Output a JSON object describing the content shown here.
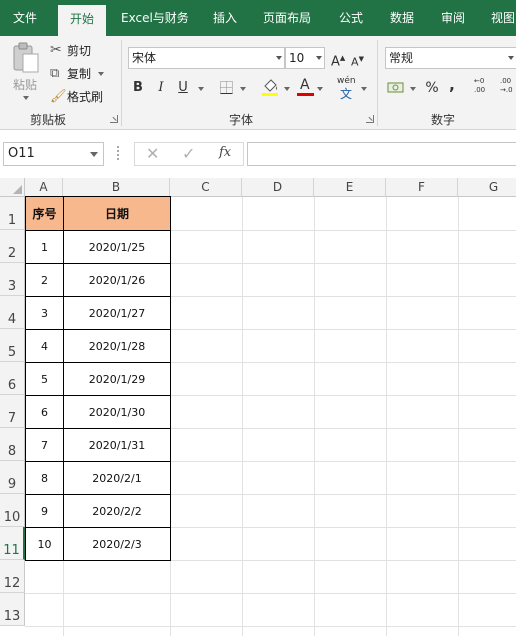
{
  "ribbon_tabs": [
    "文件",
    "开始",
    "Excel与财务",
    "插入",
    "页面布局",
    "公式",
    "数据",
    "审阅",
    "视图"
  ],
  "active_tab": "开始",
  "clipboard": {
    "paste_label": "粘贴",
    "cut_label": "剪切",
    "copy_label": "复制",
    "format_painter_label": "格式刷",
    "group_label": "剪贴板"
  },
  "font": {
    "font_name": "宋体",
    "font_size": "10",
    "bold": "B",
    "italic": "I",
    "underline": "U",
    "font_color_glyph": "A",
    "phonetic_glyph": "wén",
    "group_label": "字体"
  },
  "number": {
    "format": "常规",
    "percent": "%",
    "comma": ",",
    "group_label": "数字"
  },
  "formula_bar": {
    "name_box": "O11",
    "fx": "fx",
    "formula": ""
  },
  "columns": [
    "A",
    "B",
    "C",
    "D",
    "E",
    "F",
    "G"
  ],
  "rows": [
    "1",
    "2",
    "3",
    "4",
    "5",
    "6",
    "7",
    "8",
    "9",
    "10",
    "11",
    "12",
    "13"
  ],
  "table": {
    "headers": [
      "序号",
      "日期"
    ],
    "rows": [
      [
        "1",
        "2020/1/25"
      ],
      [
        "2",
        "2020/1/26"
      ],
      [
        "3",
        "2020/1/27"
      ],
      [
        "4",
        "2020/1/28"
      ],
      [
        "5",
        "2020/1/29"
      ],
      [
        "6",
        "2020/1/30"
      ],
      [
        "7",
        "2020/1/31"
      ],
      [
        "8",
        "2020/2/1"
      ],
      [
        "9",
        "2020/2/2"
      ],
      [
        "10",
        "2020/2/3"
      ]
    ]
  },
  "colors": {
    "ribbon_green": "#217346",
    "header_fill": "#f8b88e",
    "font_color_bar": "#e00000",
    "highlight_bar": "#ffff00"
  }
}
